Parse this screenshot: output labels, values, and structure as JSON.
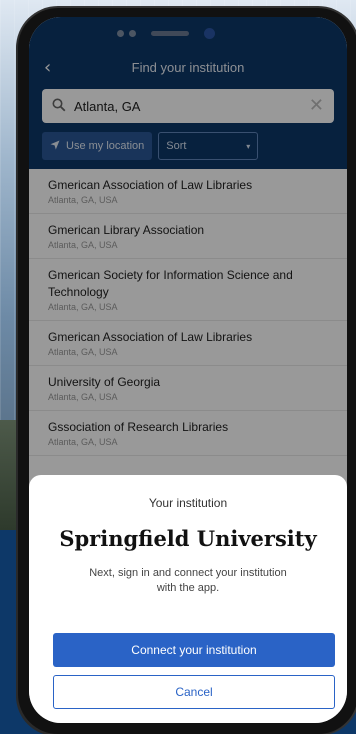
{
  "header": {
    "title": "Find your institution",
    "back_icon": "chevron-left-icon"
  },
  "search": {
    "value": "Atlanta, GA",
    "icon": "search-icon",
    "clear_icon": "close-icon"
  },
  "controls": {
    "location_label": "Use my location",
    "location_icon": "location-arrow-icon",
    "sort_label": "Sort",
    "sort_icon": "chevron-down-icon"
  },
  "results": [
    {
      "name": "Gmerican Association of Law Libraries",
      "location": "Atlanta, GA, USA"
    },
    {
      "name": "Gmerican Library Association",
      "location": "Atlanta, GA, USA"
    },
    {
      "name": "Gmerican Society for Information Science and Technology",
      "location": "Atlanta, GA, USA"
    },
    {
      "name": "Gmerican Association of Law Libraries",
      "location": "Atlanta, GA, USA"
    },
    {
      "name": "University of Georgia",
      "location": "Atlanta, GA, USA"
    },
    {
      "name": "Gssociation of Research Libraries",
      "location": "Atlanta, GA, USA"
    }
  ],
  "sheet": {
    "label": "Your institution",
    "institution": "Springfield University",
    "description": "Next, sign in and connect your institution with the app.",
    "connect_label": "Connect your institution",
    "cancel_label": "Cancel"
  },
  "colors": {
    "brand_navy": "#0d3868",
    "accent_blue": "#2a63c6"
  }
}
